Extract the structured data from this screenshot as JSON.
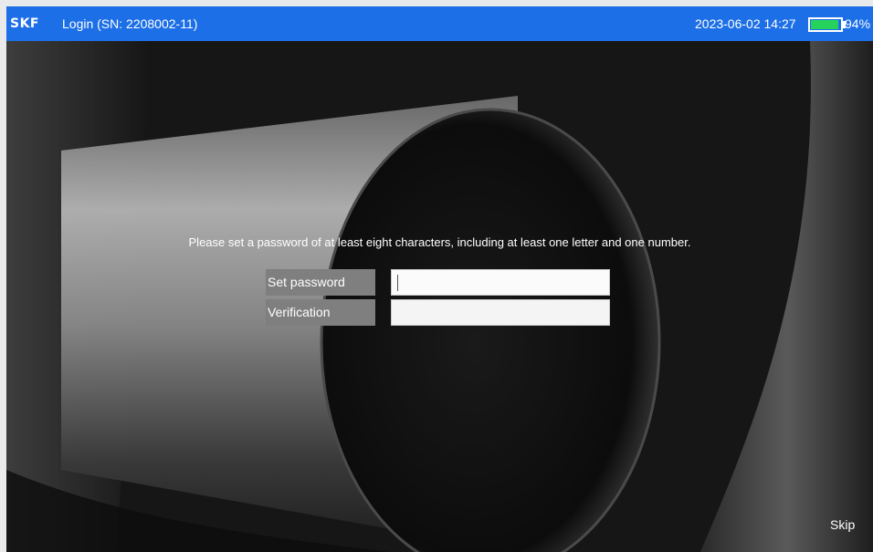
{
  "topbar": {
    "logo": "SKF",
    "title": "Login (SN:  2208002-11)",
    "datetime": "2023-06-02 14:27",
    "battery_percent": "94%",
    "battery_level": 0.94,
    "battery_color": "#25d35c",
    "bar_color": "#1c6fe6"
  },
  "form": {
    "message": "Please set a password of at least eight characters, including at least one letter and one number.",
    "set_password_label": "Set password",
    "verification_label": "Verification",
    "set_password_value": "",
    "verification_value": ""
  },
  "footer": {
    "skip_label": "Skip"
  }
}
